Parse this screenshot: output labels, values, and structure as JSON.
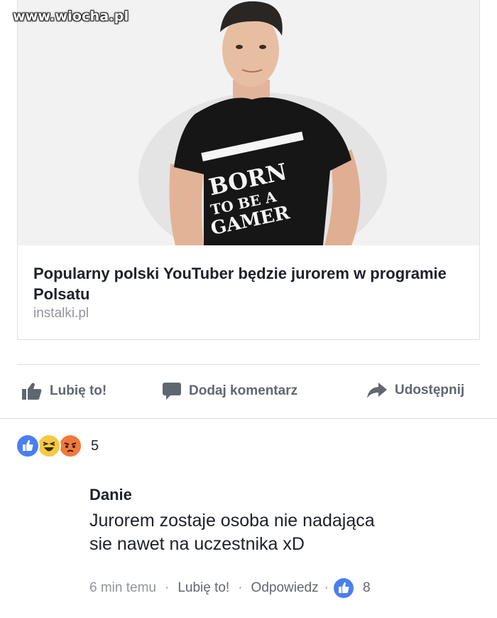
{
  "watermark": "www.wiocha.pl",
  "link_card": {
    "title": "Popularny polski YouTuber będzie jurorem w programie Polsatu",
    "domain": "instalki.pl",
    "image_shirt_text": "BORN TO BE A GAMER"
  },
  "actions": {
    "like_label": "Lubię to!",
    "comment_label": "Dodaj komentarz",
    "share_label": "Udostępnij"
  },
  "reactions": {
    "icons": [
      "like-icon",
      "haha-icon",
      "angry-icon"
    ],
    "count": "5"
  },
  "comment": {
    "author": "Danie",
    "text_line1": "Jurorem zostaje osoba nie nadająca",
    "text_line2": "sie nawet na uczestnika xD",
    "time": "6 min temu",
    "like_label": "Lubię to!",
    "reply_label": "Odpowiedz",
    "like_count": "8"
  },
  "colors": {
    "fb_blue": "#4267b2",
    "text": "#1d2129",
    "muted": "#90949c",
    "action_gray": "#606770",
    "border": "#dddfe2"
  }
}
